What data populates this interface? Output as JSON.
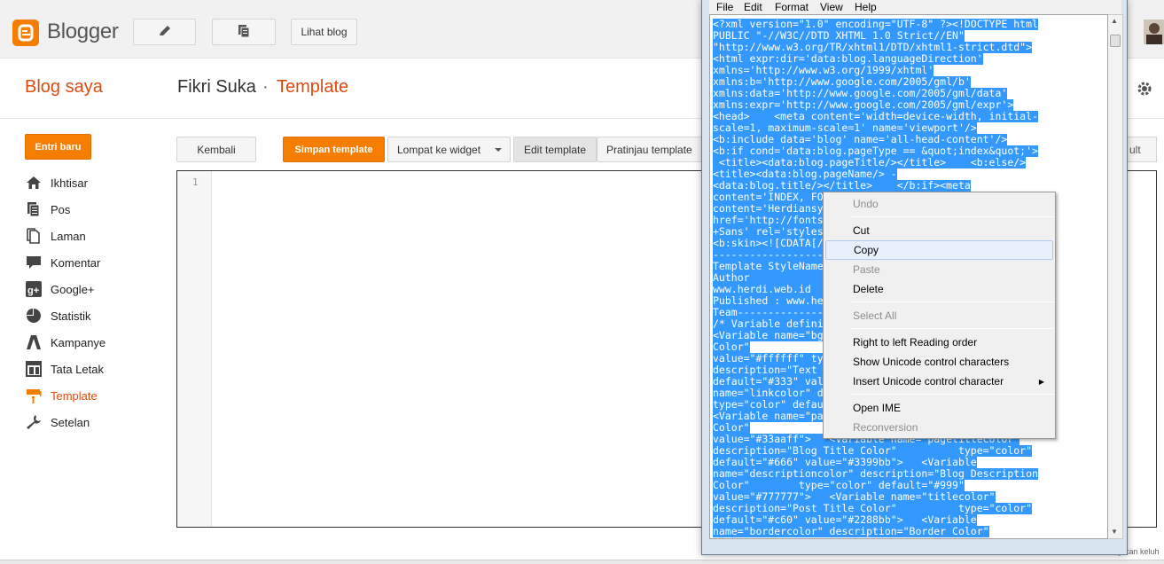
{
  "blogger": {
    "logo_text": "Blogger",
    "view_blog_label": "Lihat blog",
    "blog_saya": "Blog saya",
    "blog_name": "Fikri Suka",
    "separator": "·",
    "page_title": "Template"
  },
  "sidebar": {
    "new_post_label": "Entri baru",
    "items": [
      {
        "label": "Ikhtisar",
        "icon": "home-icon"
      },
      {
        "label": "Pos",
        "icon": "posts-icon"
      },
      {
        "label": "Laman",
        "icon": "pages-icon"
      },
      {
        "label": "Komentar",
        "icon": "comment-icon"
      },
      {
        "label": "Google+",
        "icon": "google-plus-icon"
      },
      {
        "label": "Statistik",
        "icon": "pie-chart-icon"
      },
      {
        "label": "Kampanye",
        "icon": "campaign-icon"
      },
      {
        "label": "Tata Letak",
        "icon": "layout-icon"
      },
      {
        "label": "Template",
        "icon": "template-icon",
        "active": true
      },
      {
        "label": "Setelan",
        "icon": "wrench-icon"
      }
    ]
  },
  "editor_toolbar": {
    "back_label": "Kembali",
    "save_label": "Simpan template",
    "jump_label": "Lompat ke widget",
    "edit_label": "Edit template",
    "preview_label": "Pratinjau template",
    "overflow_label": "ult"
  },
  "editor": {
    "line_number": "1"
  },
  "notepad": {
    "menus": [
      "File",
      "Edit",
      "Format",
      "View",
      "Help"
    ],
    "lines": [
      "<?xml version=\"1.0\" encoding=\"UTF-8\" ?><!DOCTYPE html",
      "PUBLIC \"-//W3C//DTD XHTML 1.0 Strict//EN\"",
      "\"http://www.w3.org/TR/xhtml1/DTD/xhtml1-strict.dtd\">",
      "<html expr:dir='data:blog.languageDirection'",
      "xmlns='http://www.w3.org/1999/xhtml'",
      "xmlns:b='http://www.google.com/2005/gml/b'",
      "xmlns:data='http://www.google.com/2005/gml/data'",
      "xmlns:expr='http://www.google.com/2005/gml/expr'>",
      "<head>    <meta content='width=device-width, initial-",
      "scale=1, maximum-scale=1' name='viewport'/>",
      "<b:include data='blog' name='all-head-content'/>",
      "<b:if cond='data:blog.pageType == &quot;index&quot;'>",
      " <title><data:blog.pageTitle/></title>    <b:else/>",
      "<title><data:blog.pageName/> -",
      "<data:blog.title/></title>    </b:if><meta",
      "content='INDEX, FOLLOW' name='ROBOTS'/><meta",
      "content='Herdiansyah' name='author'/><link",
      "href='http://fonts.googleapis.com/css?family=Droid",
      "+Sans' rel='stylesheet' type='text/css'/>",
      "<b:skin><![CDATA[/*",
      "-----------------------------------------------Blogger",
      "Template StyleName:     Herdi Blogger Themes",
      "Author             :    Herdiansyah",
      "www.herdi.web.id                               Url",
      "Published : www.herdi.web.id by     Blogger",
      "Team-------------------------------------------- */",
      "/* Variable definitions   ====================",
      "<Variable name=\"bgcolor\" description=\"Background",
      "Color\"",
      "value=\"#ffffff\" type=\"color\" default=\"#fff\">",
      "description=\"Text Color\" type=\"color\"",
      "default=\"#333\" value=\"#333333\">   <Variable",
      "name=\"linkcolor\" description=\"Link Color\"",
      "type=\"color\" default=\"#58a\" value=\"#3399bb\">",
      "<Variable name=\"pagetitlecolor\"               er",
      "Color\"",
      "value=\"#33aaff\">   <Variable name=\"pagetitlecolor\"",
      "description=\"Blog Title Color\"          type=\"color\"",
      "default=\"#666\" value=\"#3399bb\">   <Variable",
      "name=\"descriptioncolor\" description=\"Blog Description",
      "Color\"        type=\"color\" default=\"#999\"",
      "value=\"#777777\">   <Variable name=\"titlecolor\"",
      "description=\"Post Title Color\"          type=\"color\"",
      "default=\"#c60\" value=\"#2288bb\">   <Variable",
      "name=\"bordercolor\" description=\"Border Color\""
    ]
  },
  "context_menu": {
    "items": [
      {
        "label": "Undo",
        "disabled": true
      },
      {
        "separator": true
      },
      {
        "label": "Cut"
      },
      {
        "label": "Copy",
        "hover": true
      },
      {
        "label": "Paste",
        "disabled": true
      },
      {
        "label": "Delete"
      },
      {
        "separator": true
      },
      {
        "label": "Select All",
        "disabled": true
      },
      {
        "separator": true
      },
      {
        "label": "Right to left Reading order"
      },
      {
        "label": "Show Unicode control characters"
      },
      {
        "label": "Insert Unicode control character",
        "submenu": true
      },
      {
        "separator": true
      },
      {
        "label": "Open IME"
      },
      {
        "label": "Reconversion",
        "disabled": true
      }
    ]
  },
  "overflow": {
    "bottom_text": "Ajukan keluh"
  },
  "colors": {
    "accent": "#f57d00",
    "selection": "#3399ff"
  }
}
